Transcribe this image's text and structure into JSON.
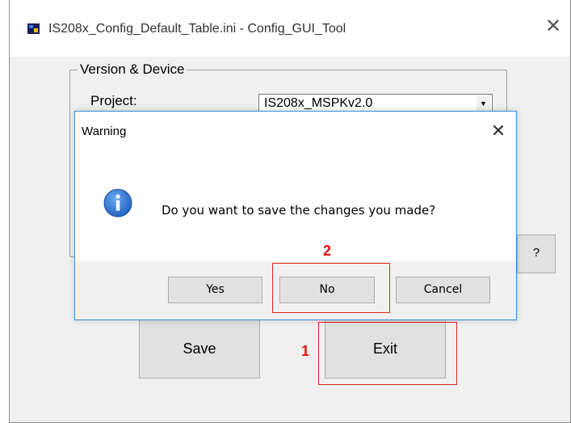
{
  "window": {
    "title": "IS208x_Config_Default_Table.ini - Config_GUI_Tool",
    "close_glyph": "✕"
  },
  "group": {
    "label": "Version & Device",
    "project_label": "Project:",
    "project_value": "IS208x_MSPKv2.0",
    "dropdown_arrow": "▼"
  },
  "buttons": {
    "help": "?",
    "save": "Save",
    "exit": "Exit"
  },
  "annotations": {
    "exit_number": "1",
    "no_number": "2",
    "color": "#e02424"
  },
  "dialog": {
    "title": "Warning",
    "close_glyph": "✕",
    "icon": "info-icon",
    "message": "Do you want to save the changes you made?",
    "yes": "Yes",
    "no": "No",
    "cancel": "Cancel"
  }
}
